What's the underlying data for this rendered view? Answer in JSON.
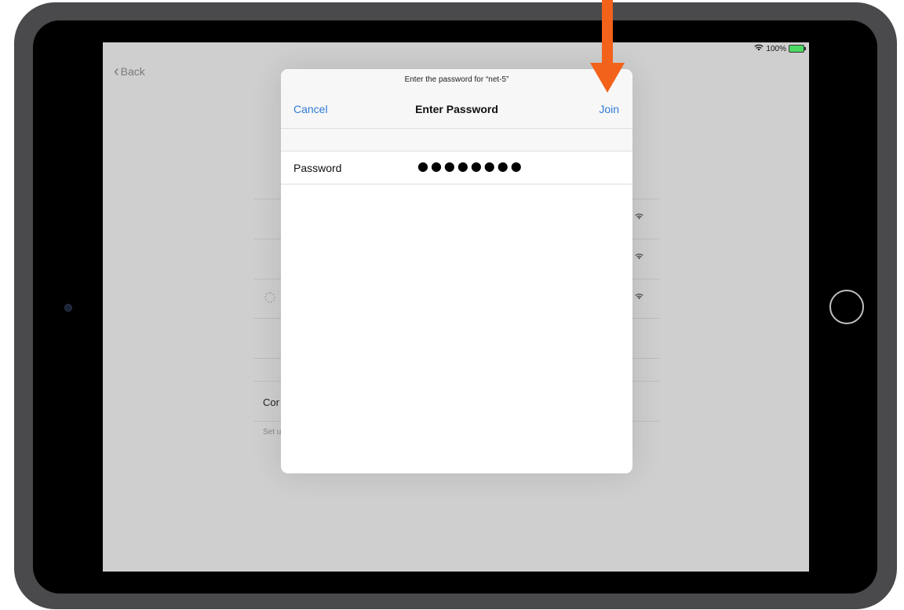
{
  "status": {
    "battery": "100%",
    "wifi_icon": "wifi-icon"
  },
  "nav": {
    "back_label": "Back"
  },
  "background": {
    "section_text": "Cor",
    "section_sub": "Set u"
  },
  "dialog": {
    "prompt": "Enter the password for “net-5”",
    "title": "Enter Password",
    "cancel_label": "Cancel",
    "join_label": "Join",
    "password_label": "Password",
    "password_value": "●●●●●●●●"
  },
  "annotation": {
    "arrow_color": "#f2621a"
  }
}
